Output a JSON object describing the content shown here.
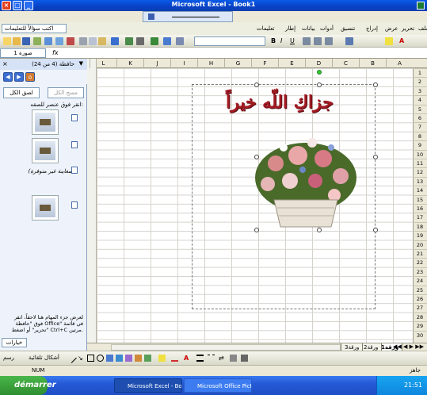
{
  "window": {
    "title": "Microsoft Excel - Book1"
  },
  "menubar": {
    "help_box": "اكتب سؤالاً للتعليمات",
    "items": [
      "تعليمات",
      "إطار",
      "بيانات",
      "أدوات",
      "تنسيق",
      "إدراج",
      "عرض",
      "تحرير",
      "ملف"
    ]
  },
  "formula_bar": {
    "name_box": "صورة 1"
  },
  "task_pane": {
    "title": "حافظة (4 من 24)",
    "paste_all": "لصق الكل",
    "clear_all": "مسح الكل",
    "hint": "انقر فوق عنصر للصقه:",
    "clip_label": "(المعاينة غير متوفرة)",
    "footer": "لعرض جزء المهام هنا لاحقاً، انقر فوق \"حافظة Office\" في قائمة \"تحرير\" أو اضغط Ctrl+C مرتين.",
    "options": "خيارات"
  },
  "columns": [
    "A",
    "B",
    "C",
    "D",
    "E",
    "F",
    "G",
    "H",
    "I",
    "J",
    "K",
    "L"
  ],
  "rows": [
    "1",
    "2",
    "3",
    "4",
    "5",
    "6",
    "7",
    "8",
    "9",
    "10",
    "11",
    "12",
    "13",
    "14",
    "15",
    "16",
    "17",
    "18",
    "19",
    "20",
    "21",
    "22",
    "23",
    "24",
    "25",
    "26",
    "27",
    "28",
    "29",
    "30"
  ],
  "picture": {
    "caption": "جزاكِ اللّه خيراً"
  },
  "sheet_tabs": [
    "ورقة1",
    "ورقة2",
    "ورقة3"
  ],
  "drawing_bar": {
    "autoshapes": "أشكال تلقائية",
    "draw": "رسم"
  },
  "status": {
    "num": "NUM",
    "ready": "جاهز"
  },
  "taskbar": {
    "start": "démarrer",
    "tasks": [
      "Microsoft Excel - Book1",
      "Microsoft Office Pict..."
    ],
    "clock": "21:51"
  },
  "colors": {
    "caption": "#a31a22",
    "title": "#0a5be8"
  }
}
